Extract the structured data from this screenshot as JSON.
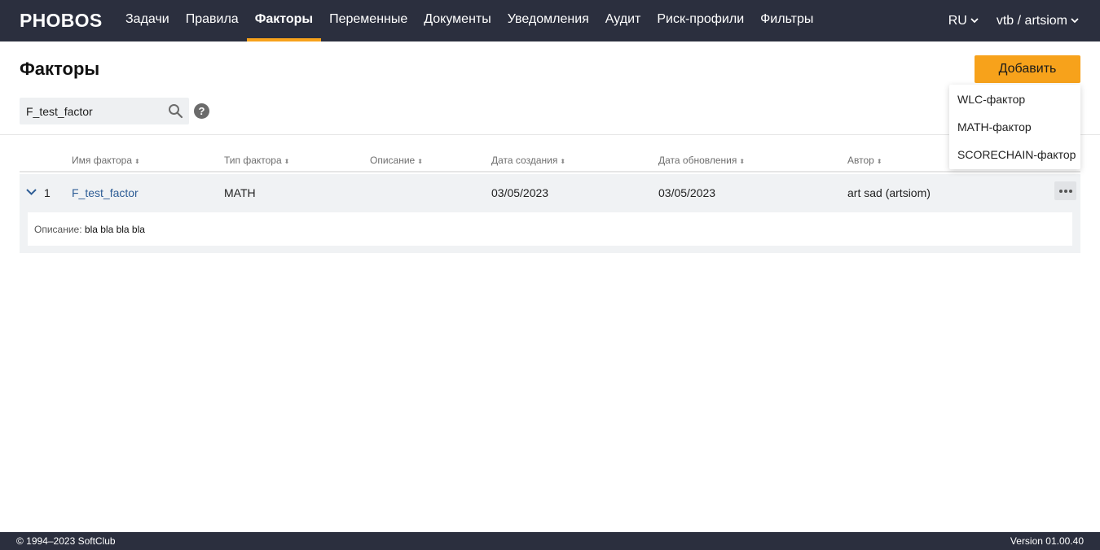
{
  "app": {
    "logo": "PHOBOS"
  },
  "nav": {
    "items": [
      {
        "label": "Задачи"
      },
      {
        "label": "Правила"
      },
      {
        "label": "Факторы"
      },
      {
        "label": "Переменные"
      },
      {
        "label": "Документы"
      },
      {
        "label": "Уведомления"
      },
      {
        "label": "Аудит"
      },
      {
        "label": "Риск-профили"
      },
      {
        "label": "Фильтры"
      }
    ],
    "active": "Факторы",
    "language": "RU",
    "user": "vtb / artsiom"
  },
  "page": {
    "title": "Факторы",
    "add_button": "Добавить",
    "add_menu": [
      "WLC-фактор",
      "MATH-фактор",
      "SCORECHAIN-фактор"
    ]
  },
  "search": {
    "value": "F_test_factor",
    "help": "?"
  },
  "table": {
    "columns": [
      "Имя фактора",
      "Тип фактора",
      "Описание",
      "Дата создания",
      "Дата обновления",
      "Автор"
    ],
    "sort_icon": "⬍",
    "rows": [
      {
        "index": "1",
        "name": "F_test_factor",
        "type": "MATH",
        "description": "",
        "created": "03/05/2023",
        "updated": "03/05/2023",
        "author": "art sad (artsiom)",
        "details_label": "Описание:",
        "details_value": "bla bla bla bla"
      }
    ]
  },
  "footer": {
    "copyright": "© 1994–2023 SoftClub",
    "version": "Version 01.00.40"
  },
  "colors": {
    "nav_bg": "#2b2f3e",
    "accent": "#f7a21b",
    "link": "#2f5e96"
  }
}
